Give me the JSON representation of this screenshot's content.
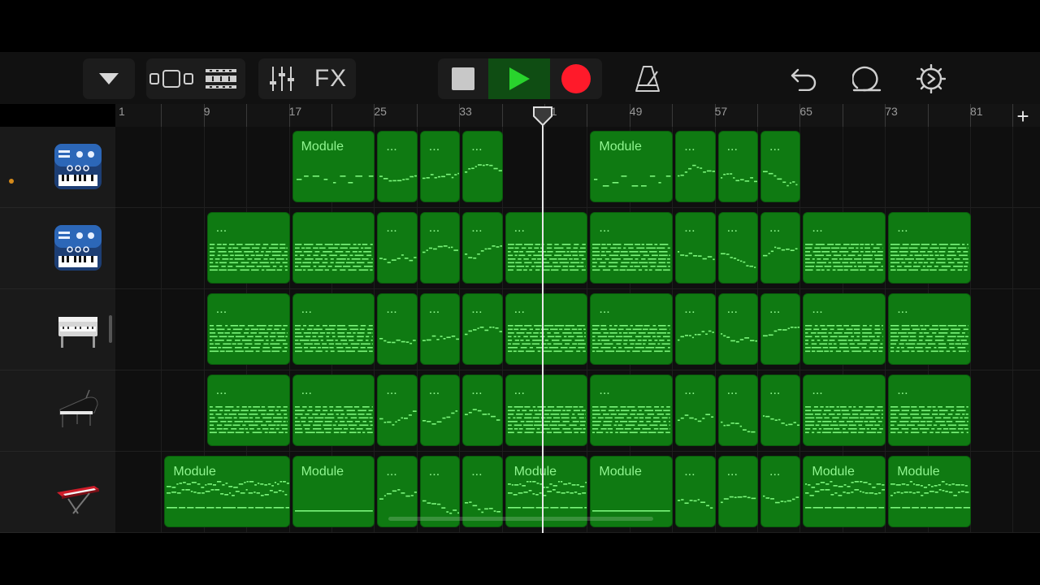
{
  "toolbar": {
    "fx_label": "FX",
    "icons": [
      "view-menu-icon",
      "tracks-view-icon",
      "loop-browser-icon",
      "mixer-icon",
      "stop-icon",
      "play-icon",
      "record-icon",
      "metronome-icon",
      "undo-icon",
      "loop-icon",
      "settings-icon"
    ],
    "colors": {
      "play": "#29d32d",
      "record": "#ff1a2a",
      "active_bg": "#0f4d13"
    }
  },
  "ruler": {
    "bar_numbers": [
      "1",
      "9",
      "17",
      "25",
      "33",
      "41",
      "49",
      "57",
      "65",
      "73",
      "81"
    ]
  },
  "playhead": {
    "position_bar": 40.7
  },
  "colors": {
    "region": "#0f7a12",
    "note": "#7cf57c",
    "label": "#8ff58f"
  },
  "tracks": [
    {
      "instrument": "synth-keyboard-icon",
      "regions": [
        {
          "start": 17,
          "end": 25,
          "label": "Module",
          "style": "sparse"
        },
        {
          "start": 25,
          "end": 29,
          "label": "...",
          "style": "melody"
        },
        {
          "start": 29,
          "end": 33,
          "label": "...",
          "style": "melody"
        },
        {
          "start": 33,
          "end": 37,
          "label": "...",
          "style": "melody"
        },
        {
          "start": 45,
          "end": 53,
          "label": "Module",
          "style": "sparse"
        },
        {
          "start": 53,
          "end": 57,
          "label": "...",
          "style": "melody"
        },
        {
          "start": 57,
          "end": 61,
          "label": "...",
          "style": "melody"
        },
        {
          "start": 61,
          "end": 65,
          "label": "...",
          "style": "melody"
        }
      ]
    },
    {
      "instrument": "synth-keyboard-icon",
      "regions": [
        {
          "start": 9,
          "end": 17,
          "label": "...",
          "style": "dense"
        },
        {
          "start": 17,
          "end": 25,
          "label": "",
          "style": "dense"
        },
        {
          "start": 25,
          "end": 29,
          "label": "...",
          "style": "melody"
        },
        {
          "start": 29,
          "end": 33,
          "label": "...",
          "style": "melody"
        },
        {
          "start": 33,
          "end": 37,
          "label": "...",
          "style": "melody"
        },
        {
          "start": 37,
          "end": 45,
          "label": "...",
          "style": "dense"
        },
        {
          "start": 45,
          "end": 53,
          "label": "...",
          "style": "dense"
        },
        {
          "start": 53,
          "end": 57,
          "label": "...",
          "style": "melody"
        },
        {
          "start": 57,
          "end": 61,
          "label": "...",
          "style": "melody"
        },
        {
          "start": 61,
          "end": 65,
          "label": "...",
          "style": "melody"
        },
        {
          "start": 65,
          "end": 73,
          "label": "...",
          "style": "dense"
        },
        {
          "start": 73,
          "end": 81,
          "label": "...",
          "style": "dense"
        }
      ]
    },
    {
      "instrument": "electric-piano-icon",
      "regions": [
        {
          "start": 9,
          "end": 17,
          "label": "...",
          "style": "dense"
        },
        {
          "start": 17,
          "end": 25,
          "label": "...",
          "style": "dense"
        },
        {
          "start": 25,
          "end": 29,
          "label": "...",
          "style": "melody"
        },
        {
          "start": 29,
          "end": 33,
          "label": "...",
          "style": "melody"
        },
        {
          "start": 33,
          "end": 37,
          "label": "...",
          "style": "melody"
        },
        {
          "start": 37,
          "end": 45,
          "label": "...",
          "style": "dense"
        },
        {
          "start": 45,
          "end": 53,
          "label": "...",
          "style": "dense"
        },
        {
          "start": 53,
          "end": 57,
          "label": "...",
          "style": "melody"
        },
        {
          "start": 57,
          "end": 61,
          "label": "...",
          "style": "melody"
        },
        {
          "start": 61,
          "end": 65,
          "label": "...",
          "style": "melody"
        },
        {
          "start": 65,
          "end": 73,
          "label": "...",
          "style": "dense"
        },
        {
          "start": 73,
          "end": 81,
          "label": "...",
          "style": "dense"
        }
      ]
    },
    {
      "instrument": "grand-piano-icon",
      "regions": [
        {
          "start": 9,
          "end": 17,
          "label": "...",
          "style": "dense"
        },
        {
          "start": 17,
          "end": 25,
          "label": "...",
          "style": "dense"
        },
        {
          "start": 25,
          "end": 29,
          "label": "...",
          "style": "melody"
        },
        {
          "start": 29,
          "end": 33,
          "label": "...",
          "style": "melody"
        },
        {
          "start": 33,
          "end": 37,
          "label": "...",
          "style": "melody"
        },
        {
          "start": 37,
          "end": 45,
          "label": "...",
          "style": "dense"
        },
        {
          "start": 45,
          "end": 53,
          "label": "...",
          "style": "dense"
        },
        {
          "start": 53,
          "end": 57,
          "label": "...",
          "style": "melody"
        },
        {
          "start": 57,
          "end": 61,
          "label": "...",
          "style": "melody"
        },
        {
          "start": 61,
          "end": 65,
          "label": "...",
          "style": "melody"
        },
        {
          "start": 65,
          "end": 73,
          "label": "...",
          "style": "dense"
        },
        {
          "start": 73,
          "end": 81,
          "label": "...",
          "style": "dense"
        }
      ]
    },
    {
      "instrument": "stage-keyboard-icon",
      "regions": [
        {
          "start": 5,
          "end": 17,
          "label": "Module",
          "style": "wave"
        },
        {
          "start": 17,
          "end": 25,
          "label": "Module",
          "style": "line"
        },
        {
          "start": 25,
          "end": 29,
          "label": "...",
          "style": "melody"
        },
        {
          "start": 29,
          "end": 33,
          "label": "...",
          "style": "melody"
        },
        {
          "start": 33,
          "end": 37,
          "label": "...",
          "style": "melody"
        },
        {
          "start": 37,
          "end": 45,
          "label": "Module",
          "style": "wave"
        },
        {
          "start": 45,
          "end": 53,
          "label": "Module",
          "style": "line"
        },
        {
          "start": 53,
          "end": 57,
          "label": "...",
          "style": "melody"
        },
        {
          "start": 57,
          "end": 61,
          "label": "...",
          "style": "melody"
        },
        {
          "start": 61,
          "end": 65,
          "label": "...",
          "style": "melody"
        },
        {
          "start": 65,
          "end": 73,
          "label": "Module",
          "style": "wave"
        },
        {
          "start": 73,
          "end": 81,
          "label": "Module",
          "style": "wave"
        }
      ]
    }
  ]
}
